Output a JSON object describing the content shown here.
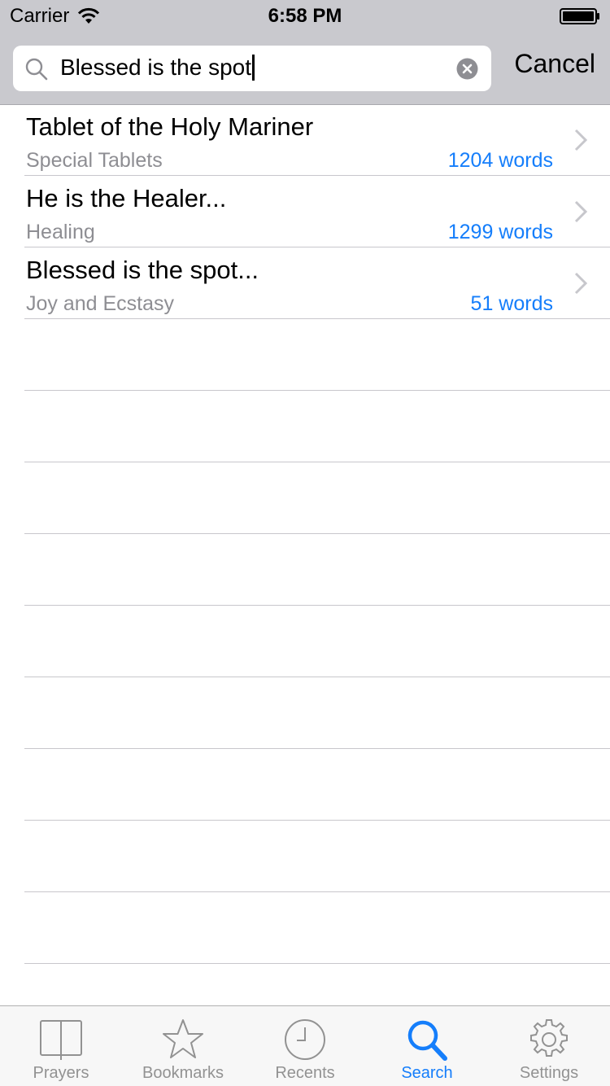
{
  "status_bar": {
    "carrier": "Carrier",
    "time": "6:58 PM"
  },
  "search": {
    "query": "Blessed is the spot",
    "cancel_label": "Cancel"
  },
  "results": [
    {
      "title": "Tablet of the Holy Mariner",
      "category": "Special Tablets",
      "words": "1204 words"
    },
    {
      "title": "He is the Healer...",
      "category": "Healing",
      "words": "1299 words"
    },
    {
      "title": "Blessed is the spot...",
      "category": "Joy and Ecstasy",
      "words": "51 words"
    }
  ],
  "tabs": [
    {
      "label": "Prayers",
      "icon": "book-icon",
      "active": false
    },
    {
      "label": "Bookmarks",
      "icon": "star-icon",
      "active": false
    },
    {
      "label": "Recents",
      "icon": "clock-icon",
      "active": false
    },
    {
      "label": "Search",
      "icon": "search-icon",
      "active": true
    },
    {
      "label": "Settings",
      "icon": "gear-icon",
      "active": false
    }
  ],
  "colors": {
    "accent": "#157efb",
    "inactive_tab": "#929292",
    "header_bg": "#c9c9ce",
    "secondary_text": "#8e8e93"
  }
}
